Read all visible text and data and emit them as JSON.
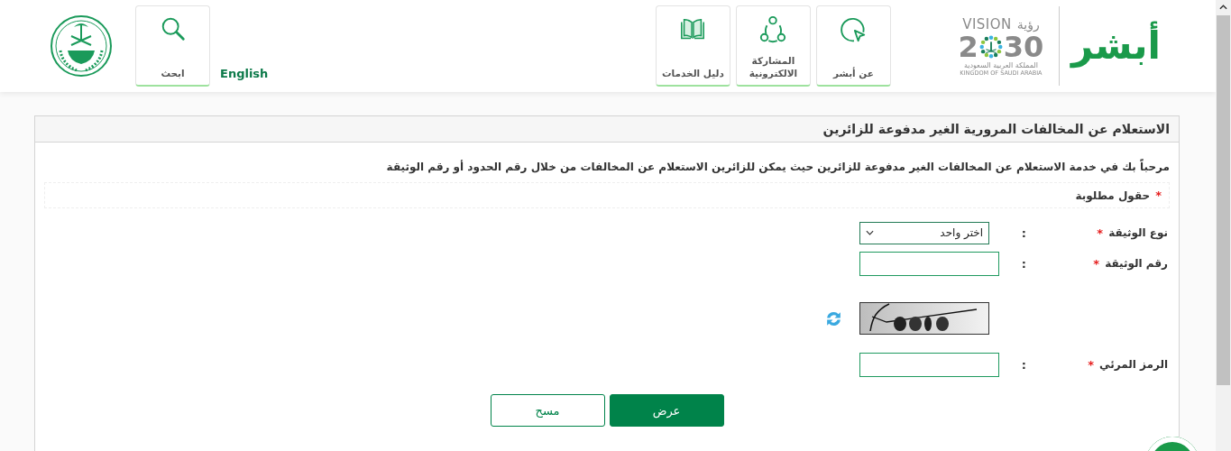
{
  "header": {
    "logo": {
      "brand": "أبشر",
      "vision_word": "VISION",
      "vision_arabic": "رؤية",
      "year_first": "2",
      "year_rest": "30",
      "kingdom_arabic": "المملكة العربية السعودية",
      "kingdom_english": "KINGDOM OF SAUDI ARABIA"
    },
    "nav_tiles": [
      {
        "label": "عن أبشر",
        "kind": "cursor"
      },
      {
        "label": "المشاركة الالكترونية",
        "kind": "share"
      },
      {
        "label": "دليل الخدمات",
        "kind": "book"
      }
    ],
    "language_link": "English",
    "search_tile": {
      "label": "ابحث"
    }
  },
  "panel": {
    "title": "الاستعلام عن المخالفات المرورية الغير مدفوعة للزائرين",
    "intro": "مرحباً بك في خدمة الاستعلام عن المخالفات الغير مدفوعة للزائرين حيث يمكن للزائرين الاستعلام عن المخالفات من خلال رقم الحدود أو رقم الوثيقة",
    "required_note": {
      "mark": "*",
      "text": "حقول مطلوبة"
    },
    "fields": [
      {
        "kind": "select",
        "label": "نوع الوثيقة",
        "required_mark": "*",
        "separator": ":",
        "value": "اختر واحد"
      },
      {
        "kind": "text",
        "label": "رقم الوثيقة",
        "required_mark": "*",
        "separator": ":"
      },
      {
        "kind": "captcha"
      },
      {
        "kind": "text",
        "label": "الرمز المرئي",
        "required_mark": "*",
        "separator": ":"
      }
    ],
    "buttons": [
      {
        "kind": "primary",
        "label": "عرض"
      },
      {
        "kind": "secondary",
        "label": "مسح"
      }
    ]
  }
}
